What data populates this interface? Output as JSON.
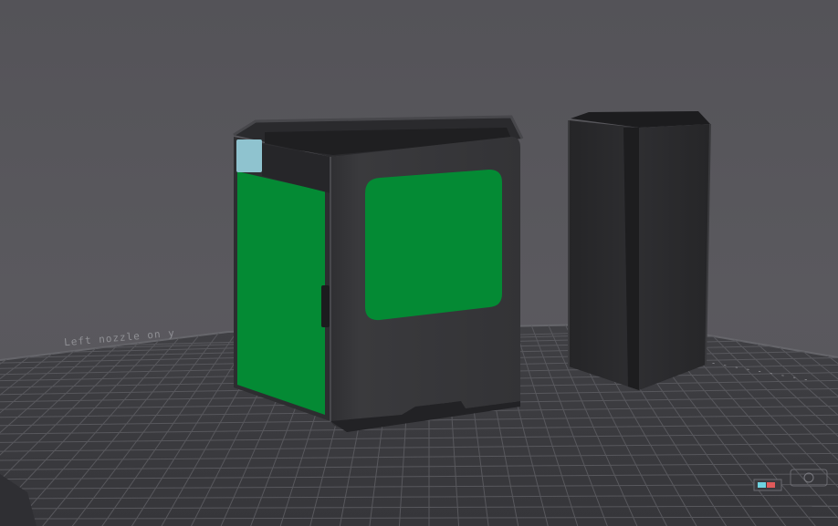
{
  "viewport": {
    "bed_label_left": "Left nozzle on y",
    "bed_label_right": "- - - - - - - - -"
  },
  "objects": [
    {
      "name": "Enclosure body",
      "colors": [
        "#353538",
        "#048a34"
      ]
    },
    {
      "name": "Side pillar",
      "colors": [
        "#2c2c2f"
      ]
    }
  ],
  "colors": {
    "background": "#56555a",
    "bed": "#3c3c40",
    "bed_grid": "#5b5b60",
    "object_dark": "#353538",
    "object_green": "#048a34",
    "selection_light": "#8fc3cf"
  },
  "icons": [
    "axis-gizmo-icon",
    "bed-logo-icon"
  ]
}
